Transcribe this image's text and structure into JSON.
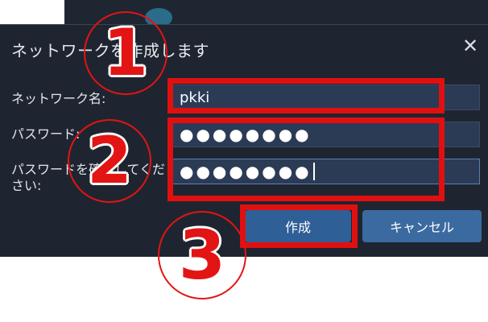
{
  "dialog": {
    "title": "ネットワークを作成します",
    "close_icon": "close-icon"
  },
  "form": {
    "network_name_label": "ネットワーク名:",
    "network_name_value": "pkki",
    "password_label": "パスワード:",
    "password_value": "●●●●●●●●",
    "confirm_label": "パスワードを確認してください:",
    "confirm_value": "●●●●●●●●"
  },
  "buttons": {
    "create": "作成",
    "cancel": "キャンセル"
  },
  "annotations": {
    "step1": "1",
    "step2": "2",
    "step3": "3",
    "color": "#e31414"
  }
}
